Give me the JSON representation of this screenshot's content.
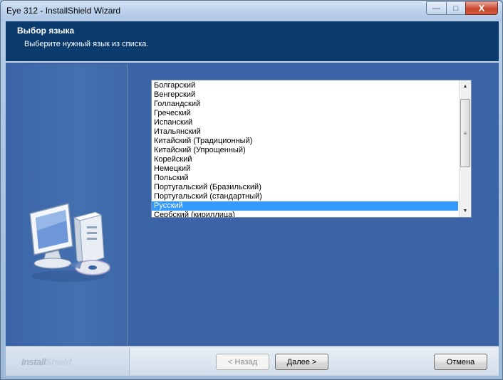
{
  "window": {
    "title": "Eye 312 - InstallShield Wizard",
    "minimize_glyph": "—",
    "maximize_glyph": "□",
    "close_glyph": "X"
  },
  "header": {
    "title": "Выбор языка",
    "subtitle": "Выберите нужный язык из списка."
  },
  "language_list": {
    "items": [
      "Болгарский",
      "Венгерский",
      "Голландский",
      "Греческий",
      "Испанский",
      "Итальянский",
      "Китайский (Традиционный)",
      "Китайский (Упрощенный)",
      "Корейский",
      "Немецкий",
      "Польский",
      "Португальский (Бразильский)",
      "Португальский (стандартный)",
      "Русский",
      "Сербский (кириллица)"
    ],
    "selected": "Русский"
  },
  "footer": {
    "brand_part1": "Install",
    "brand_part2": "Shield",
    "back_label": "< Назад",
    "next_label": "Далее >",
    "cancel_label": "Отмена"
  },
  "colors": {
    "header_bg": "#0b3b6c",
    "client_bg": "#3a64a6",
    "selection": "#3399ff"
  }
}
